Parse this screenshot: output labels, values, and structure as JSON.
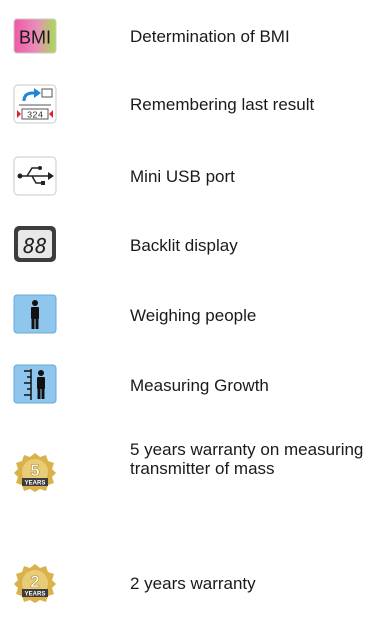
{
  "features": [
    {
      "icon": "bmi-icon",
      "label": "Determination of BMI"
    },
    {
      "icon": "memory-result-icon",
      "label": "Remembering last result"
    },
    {
      "icon": "usb-icon",
      "label": "Mini USB port"
    },
    {
      "icon": "backlit-display-icon",
      "label": "Backlit display"
    },
    {
      "icon": "person-weighing-icon",
      "label": "Weighing people"
    },
    {
      "icon": "height-measure-icon",
      "label": "Measuring Growth"
    },
    {
      "icon": "warranty-5-years-icon",
      "label": "5 years warranty on measuring transmitter of mass"
    },
    {
      "icon": "warranty-2-years-icon",
      "label": "2 years warranty"
    }
  ],
  "icon_text": {
    "bmi": "BMI",
    "memory_value": "324",
    "display_digits": "88",
    "warranty_5": "5",
    "warranty_2": "2",
    "years": "YEARS"
  },
  "colors": {
    "text": "#1a1a1a",
    "bmi_pink": "#e0308a",
    "bmi_green": "#9ed64a",
    "light_blue": "#8ec6ee",
    "arrow_blue": "#1e88d8",
    "marker_red": "#e02030",
    "display_dark": "#3d3d3d",
    "gold": "#d9b24a"
  }
}
